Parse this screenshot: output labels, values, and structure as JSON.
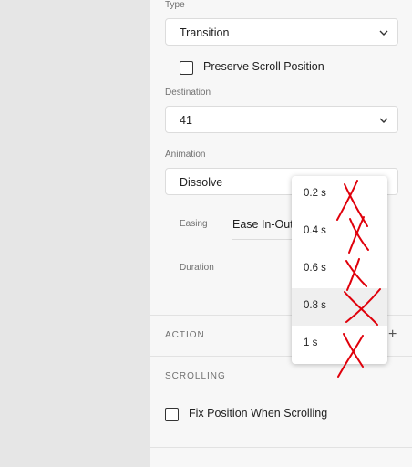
{
  "type_section": {
    "label": "Type",
    "value": "Transition"
  },
  "preserve_scroll": {
    "label": "Preserve Scroll Position",
    "checked": false
  },
  "destination": {
    "label": "Destination",
    "value": "41"
  },
  "animation": {
    "label": "Animation",
    "value": "Dissolve"
  },
  "easing": {
    "label": "Easing",
    "value": "Ease In-Out"
  },
  "duration": {
    "label": "Duration"
  },
  "action": {
    "title": "ACTION",
    "add_icon": "+"
  },
  "scrolling": {
    "title": "SCROLLING"
  },
  "fix_position": {
    "label": "Fix Position When Scrolling",
    "checked": false
  },
  "duration_dropdown": {
    "options": [
      "0.2 s",
      "0.4 s",
      "0.6 s",
      "0.8 s",
      "1 s"
    ],
    "highlighted": "0.8 s"
  },
  "annotation_color": "#e0000b"
}
